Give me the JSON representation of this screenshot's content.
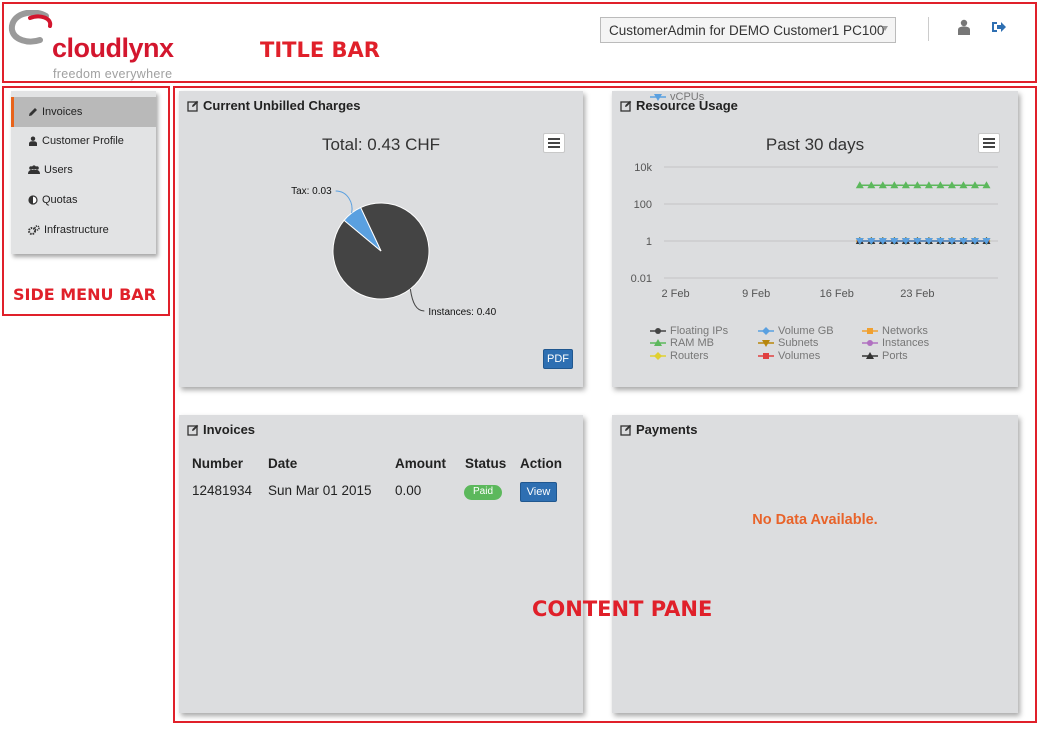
{
  "title_bar": {
    "logo_text": "cloudlynx",
    "logo_tagline": "freedom everywhere",
    "user_selector": "CustomerAdmin for DEMO Customer1 PC100",
    "region_label": "TITLE BAR"
  },
  "side_menu": {
    "region_label": "SIDE MENU BAR",
    "items": [
      {
        "label": "Invoices",
        "icon": "pencil-icon",
        "active": true
      },
      {
        "label": "Customer Profile",
        "icon": "user-icon",
        "active": false
      },
      {
        "label": "Users",
        "icon": "users-icon",
        "active": false
      },
      {
        "label": "Quotas",
        "icon": "half-circle-icon",
        "active": false
      },
      {
        "label": "Infrastructure",
        "icon": "cogs-icon",
        "active": false
      }
    ]
  },
  "content": {
    "region_label": "CONTENT PANE",
    "unbilled": {
      "title": "Current Unbilled Charges",
      "total": "Total: 0.43 CHF",
      "pdf_label": "PDF"
    },
    "resource": {
      "title": "Resource Usage",
      "subtitle": "Past 30 days"
    },
    "invoices": {
      "title": "Invoices",
      "columns": [
        "Number",
        "Date",
        "Amount",
        "Status",
        "Action"
      ],
      "rows": [
        {
          "number": "12481934",
          "date": "Sun Mar 01 2015",
          "amount": "0.00",
          "status": "Paid",
          "action": "View"
        }
      ]
    },
    "payments": {
      "title": "Payments",
      "empty_text": "No Data Available."
    }
  },
  "colors": {
    "brand_red": "#d3162e",
    "annotation_red": "#e0202a",
    "active_accent": "#e8631a",
    "button_blue": "#2e6fb2",
    "paid_green": "#5cb85c",
    "empty_orange": "#e8632a"
  },
  "chart_data": [
    {
      "type": "pie",
      "title": "Total: 0.43 CHF",
      "slices": [
        {
          "label": "Instances",
          "value": 0.4,
          "color": "#444444",
          "data_label": "Instances: 0.40"
        },
        {
          "label": "Tax",
          "value": 0.03,
          "color": "#5aa0e0",
          "data_label": "Tax: 0.03"
        }
      ]
    },
    {
      "type": "line",
      "title": "Past 30 days",
      "y_scale": "log",
      "y_ticks": [
        "10k",
        "100",
        "1",
        "0.01"
      ],
      "y_tick_values": [
        10000,
        100,
        1,
        0.01
      ],
      "x_ticks": [
        "2 Feb",
        "9 Feb",
        "16 Feb",
        "23 Feb"
      ],
      "x": [
        "2015-02-18",
        "2015-02-19",
        "2015-02-20",
        "2015-02-21",
        "2015-02-22",
        "2015-02-23",
        "2015-02-24",
        "2015-02-25",
        "2015-02-26",
        "2015-02-27",
        "2015-02-28",
        "2015-03-01"
      ],
      "series": [
        {
          "name": "Floating IPs",
          "color": "#444444",
          "marker": "circle",
          "values": [
            1,
            1,
            1,
            1,
            1,
            1,
            1,
            1,
            1,
            1,
            1,
            1
          ]
        },
        {
          "name": "Volume GB",
          "color": "#5aa0e0",
          "marker": "diamond",
          "values": [
            1,
            1,
            1,
            1,
            1,
            1,
            1,
            1,
            1,
            1,
            1,
            1
          ]
        },
        {
          "name": "Networks",
          "color": "#f0a030",
          "marker": "square",
          "values": [
            1,
            1,
            1,
            1,
            1,
            1,
            1,
            1,
            1,
            1,
            1,
            1
          ]
        },
        {
          "name": "RAM MB",
          "color": "#5cb85c",
          "marker": "triangle",
          "values": [
            1024,
            1024,
            1024,
            1024,
            1024,
            1024,
            1024,
            1024,
            1024,
            1024,
            1024,
            1024
          ]
        },
        {
          "name": "Subnets",
          "color": "#b8860b",
          "marker": "triangle-down",
          "values": [
            1,
            1,
            1,
            1,
            1,
            1,
            1,
            1,
            1,
            1,
            1,
            1
          ]
        },
        {
          "name": "Instances",
          "color": "#b070c0",
          "marker": "circle",
          "values": [
            1,
            1,
            1,
            1,
            1,
            1,
            1,
            1,
            1,
            1,
            1,
            1
          ]
        },
        {
          "name": "Routers",
          "color": "#e0d030",
          "marker": "diamond",
          "values": [
            1,
            1,
            1,
            1,
            1,
            1,
            1,
            1,
            1,
            1,
            1,
            1
          ]
        },
        {
          "name": "Volumes",
          "color": "#e04040",
          "marker": "square",
          "values": [
            1,
            1,
            1,
            1,
            1,
            1,
            1,
            1,
            1,
            1,
            1,
            1
          ]
        },
        {
          "name": "Ports",
          "color": "#333333",
          "marker": "triangle",
          "values": [
            1,
            1,
            1,
            1,
            1,
            1,
            1,
            1,
            1,
            1,
            1,
            1
          ]
        },
        {
          "name": "vCPUs",
          "color": "#5aa0e0",
          "marker": "triangle-down",
          "values": [
            1,
            1,
            1,
            1,
            1,
            1,
            1,
            1,
            1,
            1,
            1,
            1
          ]
        }
      ]
    }
  ]
}
